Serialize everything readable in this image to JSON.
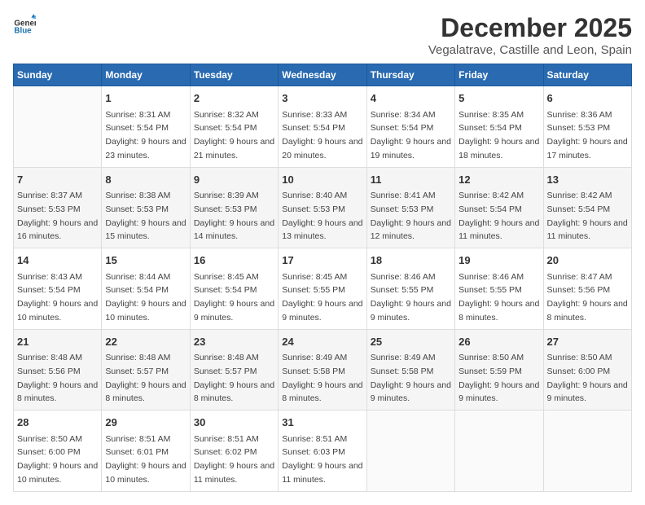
{
  "header": {
    "logo_general": "General",
    "logo_blue": "Blue",
    "main_title": "December 2025",
    "subtitle": "Vegalatrave, Castille and Leon, Spain"
  },
  "days_of_week": [
    "Sunday",
    "Monday",
    "Tuesday",
    "Wednesday",
    "Thursday",
    "Friday",
    "Saturday"
  ],
  "weeks": [
    [
      {
        "day": "",
        "sunrise": "",
        "sunset": "",
        "daylight": ""
      },
      {
        "day": "1",
        "sunrise": "Sunrise: 8:31 AM",
        "sunset": "Sunset: 5:54 PM",
        "daylight": "Daylight: 9 hours and 23 minutes."
      },
      {
        "day": "2",
        "sunrise": "Sunrise: 8:32 AM",
        "sunset": "Sunset: 5:54 PM",
        "daylight": "Daylight: 9 hours and 21 minutes."
      },
      {
        "day": "3",
        "sunrise": "Sunrise: 8:33 AM",
        "sunset": "Sunset: 5:54 PM",
        "daylight": "Daylight: 9 hours and 20 minutes."
      },
      {
        "day": "4",
        "sunrise": "Sunrise: 8:34 AM",
        "sunset": "Sunset: 5:54 PM",
        "daylight": "Daylight: 9 hours and 19 minutes."
      },
      {
        "day": "5",
        "sunrise": "Sunrise: 8:35 AM",
        "sunset": "Sunset: 5:54 PM",
        "daylight": "Daylight: 9 hours and 18 minutes."
      },
      {
        "day": "6",
        "sunrise": "Sunrise: 8:36 AM",
        "sunset": "Sunset: 5:53 PM",
        "daylight": "Daylight: 9 hours and 17 minutes."
      }
    ],
    [
      {
        "day": "7",
        "sunrise": "Sunrise: 8:37 AM",
        "sunset": "Sunset: 5:53 PM",
        "daylight": "Daylight: 9 hours and 16 minutes."
      },
      {
        "day": "8",
        "sunrise": "Sunrise: 8:38 AM",
        "sunset": "Sunset: 5:53 PM",
        "daylight": "Daylight: 9 hours and 15 minutes."
      },
      {
        "day": "9",
        "sunrise": "Sunrise: 8:39 AM",
        "sunset": "Sunset: 5:53 PM",
        "daylight": "Daylight: 9 hours and 14 minutes."
      },
      {
        "day": "10",
        "sunrise": "Sunrise: 8:40 AM",
        "sunset": "Sunset: 5:53 PM",
        "daylight": "Daylight: 9 hours and 13 minutes."
      },
      {
        "day": "11",
        "sunrise": "Sunrise: 8:41 AM",
        "sunset": "Sunset: 5:53 PM",
        "daylight": "Daylight: 9 hours and 12 minutes."
      },
      {
        "day": "12",
        "sunrise": "Sunrise: 8:42 AM",
        "sunset": "Sunset: 5:54 PM",
        "daylight": "Daylight: 9 hours and 11 minutes."
      },
      {
        "day": "13",
        "sunrise": "Sunrise: 8:42 AM",
        "sunset": "Sunset: 5:54 PM",
        "daylight": "Daylight: 9 hours and 11 minutes."
      }
    ],
    [
      {
        "day": "14",
        "sunrise": "Sunrise: 8:43 AM",
        "sunset": "Sunset: 5:54 PM",
        "daylight": "Daylight: 9 hours and 10 minutes."
      },
      {
        "day": "15",
        "sunrise": "Sunrise: 8:44 AM",
        "sunset": "Sunset: 5:54 PM",
        "daylight": "Daylight: 9 hours and 10 minutes."
      },
      {
        "day": "16",
        "sunrise": "Sunrise: 8:45 AM",
        "sunset": "Sunset: 5:54 PM",
        "daylight": "Daylight: 9 hours and 9 minutes."
      },
      {
        "day": "17",
        "sunrise": "Sunrise: 8:45 AM",
        "sunset": "Sunset: 5:55 PM",
        "daylight": "Daylight: 9 hours and 9 minutes."
      },
      {
        "day": "18",
        "sunrise": "Sunrise: 8:46 AM",
        "sunset": "Sunset: 5:55 PM",
        "daylight": "Daylight: 9 hours and 9 minutes."
      },
      {
        "day": "19",
        "sunrise": "Sunrise: 8:46 AM",
        "sunset": "Sunset: 5:55 PM",
        "daylight": "Daylight: 9 hours and 8 minutes."
      },
      {
        "day": "20",
        "sunrise": "Sunrise: 8:47 AM",
        "sunset": "Sunset: 5:56 PM",
        "daylight": "Daylight: 9 hours and 8 minutes."
      }
    ],
    [
      {
        "day": "21",
        "sunrise": "Sunrise: 8:48 AM",
        "sunset": "Sunset: 5:56 PM",
        "daylight": "Daylight: 9 hours and 8 minutes."
      },
      {
        "day": "22",
        "sunrise": "Sunrise: 8:48 AM",
        "sunset": "Sunset: 5:57 PM",
        "daylight": "Daylight: 9 hours and 8 minutes."
      },
      {
        "day": "23",
        "sunrise": "Sunrise: 8:48 AM",
        "sunset": "Sunset: 5:57 PM",
        "daylight": "Daylight: 9 hours and 8 minutes."
      },
      {
        "day": "24",
        "sunrise": "Sunrise: 8:49 AM",
        "sunset": "Sunset: 5:58 PM",
        "daylight": "Daylight: 9 hours and 8 minutes."
      },
      {
        "day": "25",
        "sunrise": "Sunrise: 8:49 AM",
        "sunset": "Sunset: 5:58 PM",
        "daylight": "Daylight: 9 hours and 9 minutes."
      },
      {
        "day": "26",
        "sunrise": "Sunrise: 8:50 AM",
        "sunset": "Sunset: 5:59 PM",
        "daylight": "Daylight: 9 hours and 9 minutes."
      },
      {
        "day": "27",
        "sunrise": "Sunrise: 8:50 AM",
        "sunset": "Sunset: 6:00 PM",
        "daylight": "Daylight: 9 hours and 9 minutes."
      }
    ],
    [
      {
        "day": "28",
        "sunrise": "Sunrise: 8:50 AM",
        "sunset": "Sunset: 6:00 PM",
        "daylight": "Daylight: 9 hours and 10 minutes."
      },
      {
        "day": "29",
        "sunrise": "Sunrise: 8:51 AM",
        "sunset": "Sunset: 6:01 PM",
        "daylight": "Daylight: 9 hours and 10 minutes."
      },
      {
        "day": "30",
        "sunrise": "Sunrise: 8:51 AM",
        "sunset": "Sunset: 6:02 PM",
        "daylight": "Daylight: 9 hours and 11 minutes."
      },
      {
        "day": "31",
        "sunrise": "Sunrise: 8:51 AM",
        "sunset": "Sunset: 6:03 PM",
        "daylight": "Daylight: 9 hours and 11 minutes."
      },
      {
        "day": "",
        "sunrise": "",
        "sunset": "",
        "daylight": ""
      },
      {
        "day": "",
        "sunrise": "",
        "sunset": "",
        "daylight": ""
      },
      {
        "day": "",
        "sunrise": "",
        "sunset": "",
        "daylight": ""
      }
    ]
  ]
}
